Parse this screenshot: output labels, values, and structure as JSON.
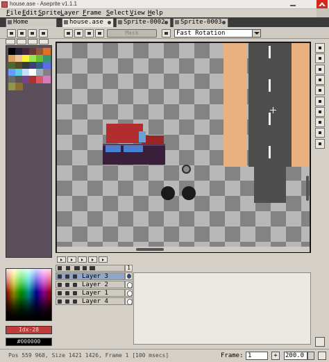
{
  "window": {
    "title": "house.ase - Aseprite v1.1.1"
  },
  "menu": [
    "File",
    "Edit",
    "Sprite",
    "Layer",
    "Frame",
    "Select",
    "View",
    "Help"
  ],
  "tabs": [
    {
      "label": "Home",
      "active": false
    },
    {
      "label": "house.ase",
      "active": true
    },
    {
      "label": "Sprite-0002",
      "active": false
    },
    {
      "label": "Sprite-0003",
      "active": false
    }
  ],
  "context_bar": {
    "mask_label": "Mask",
    "rotation_algorithm": "Fast Rotation"
  },
  "palette": {
    "swatches": [
      "#000000",
      "#222034",
      "#45283c",
      "#663931",
      "#8f563b",
      "#df7126",
      "#d9a066",
      "#eec39a",
      "#fbf236",
      "#99e550",
      "#6abe30",
      "#37946e",
      "#4b692f",
      "#524b24",
      "#323c39",
      "#3f3f74",
      "#306082",
      "#5b6ee1",
      "#639bff",
      "#5fcde4",
      "#cbdbfc",
      "#ffffff",
      "#9badb7",
      "#847e87",
      "#696a6a",
      "#595652",
      "#76428a",
      "#ac3232",
      "#d95763",
      "#d77bba",
      "#8f974a",
      "#8a6f30"
    ],
    "foreground_label": "Idx-28",
    "foreground_color": "#ac3232",
    "background_label": "#000000",
    "background_color": "#000000"
  },
  "timeline": {
    "frame_header": "1",
    "layers": [
      {
        "name": "Layer 3",
        "selected": true,
        "cel": "filled"
      },
      {
        "name": "Layer 2",
        "selected": false,
        "cel": "empty"
      },
      {
        "name": "Layer 1",
        "selected": false,
        "cel": "empty"
      },
      {
        "name": "Layer 4",
        "selected": false,
        "cel": "empty"
      }
    ]
  },
  "status": {
    "text": "Pos 559 968, Size 1421 1426, Frame 1 [100 msecs]",
    "frame_label": "Frame:",
    "frame_value": "1",
    "add_frame": "+",
    "zoom": "200.0"
  },
  "icons": {
    "tools": [
      "marquee-icon",
      "pencil-icon",
      "eraser-icon",
      "zoom-icon",
      "move-icon",
      "paint-bucket-icon",
      "line-icon",
      "ellipse-icon",
      "blur-icon",
      "eyedropper-icon"
    ]
  }
}
